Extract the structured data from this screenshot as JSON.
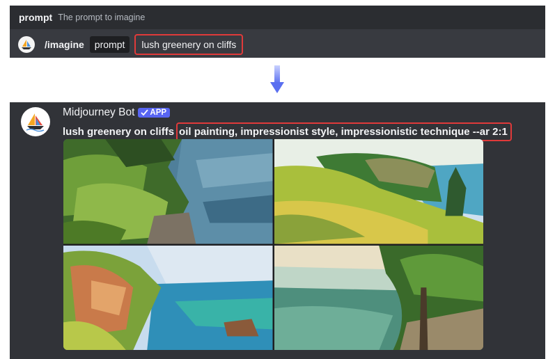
{
  "command_hint": {
    "key": "prompt",
    "description": "The prompt to imagine"
  },
  "command": {
    "name": "/imagine",
    "option_label": "prompt",
    "option_value": "lush greenery on cliffs"
  },
  "message": {
    "author": "Midjourney Bot",
    "badge": "APP",
    "prompt_base": "lush greenery on cliffs",
    "prompt_added": "oil painting, impressionist style, impressionistic technique --ar 2:1"
  },
  "images": [
    {
      "icon": "painting-green-cliff-sea"
    },
    {
      "icon": "painting-grassy-cliff-coast"
    },
    {
      "icon": "painting-rocky-shore-sunlit"
    },
    {
      "icon": "painting-tree-cliff-waves"
    }
  ],
  "colors": {
    "highlight": "#e03a3a",
    "accent": "#5865f2",
    "arrow": "#6b7ff2"
  }
}
